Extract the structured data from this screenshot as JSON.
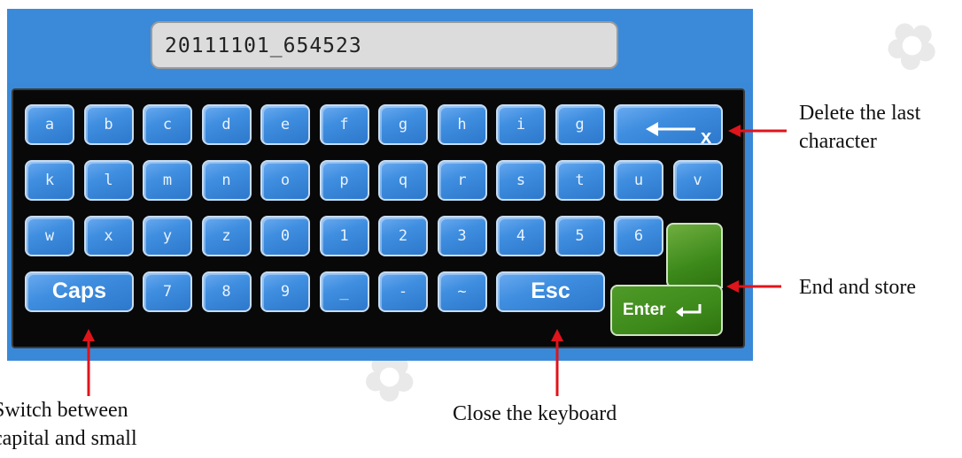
{
  "input": {
    "value": "20111101_654523"
  },
  "keyboard": {
    "row1": [
      "a",
      "b",
      "c",
      "d",
      "e",
      "f",
      "g",
      "h",
      "i",
      "g"
    ],
    "row2": [
      "k",
      "l",
      "m",
      "n",
      "o",
      "p",
      "q",
      "r",
      "s",
      "t",
      "u",
      "v"
    ],
    "row3": [
      "w",
      "x",
      "y",
      "z",
      "0",
      "1",
      "2",
      "3",
      "4",
      "5",
      "6"
    ],
    "row4": [
      "7",
      "8",
      "9",
      "_",
      "-",
      "~"
    ],
    "backspace_x": "x",
    "caps": "Caps",
    "esc": "Esc",
    "enter": "Enter"
  },
  "annotations": {
    "delete": [
      "Delete the last",
      "character"
    ],
    "end_store": "End and store",
    "caps": [
      "Switch between",
      "capital and small"
    ],
    "close": "Close the keyboard"
  },
  "colors": {
    "panel": "#3a89d8",
    "key": "#3f8ee0",
    "enter": "#3d8a1b",
    "arrow": "#e0141b"
  }
}
